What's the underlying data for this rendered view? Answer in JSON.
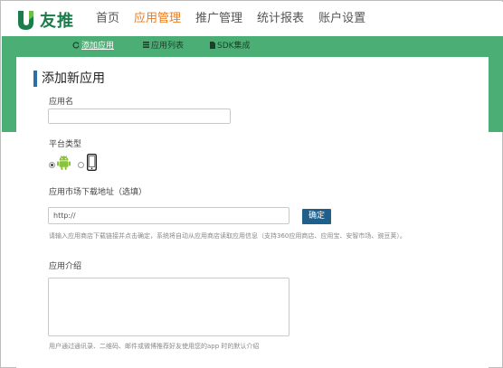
{
  "brand": {
    "name": "友推",
    "color": "#1a7d4b"
  },
  "nav": {
    "items": [
      {
        "label": "首页"
      },
      {
        "label": "应用管理",
        "active": true
      },
      {
        "label": "推广管理"
      },
      {
        "label": "统计报表"
      },
      {
        "label": "账户设置"
      }
    ]
  },
  "subnav": {
    "items": [
      {
        "label": "添加应用",
        "icon": "refresh-icon",
        "active": true
      },
      {
        "label": "应用列表",
        "icon": "list-icon"
      },
      {
        "label": "SDK集成",
        "icon": "document-icon"
      }
    ]
  },
  "colors": {
    "green": "#4bae74",
    "accent": "#f07a1a",
    "button": "#1f5f8b",
    "title_bar": "#2a6fa8"
  },
  "form": {
    "title": "添加新应用",
    "app_name": {
      "label": "应用名",
      "value": ""
    },
    "platform": {
      "label": "平台类型",
      "options": [
        {
          "name": "android",
          "icon": "android-icon",
          "checked": true
        },
        {
          "name": "ios",
          "icon": "phone-icon",
          "checked": false
        }
      ]
    },
    "market_url": {
      "label": "应用市场下载地址（选填）",
      "value": "http://",
      "confirm_label": "确定",
      "hint": "请输入应用商店下载链接并点击确定，系统将自动从应用商店读取应用信息（支持360应用商店、应用宝、安智市场、豌豆荚）。"
    },
    "description": {
      "label": "应用介绍",
      "value": "",
      "hint": "用户通过通讯录、二维码、邮件或微博推荐好友使用您的app 时的默认介绍"
    }
  }
}
